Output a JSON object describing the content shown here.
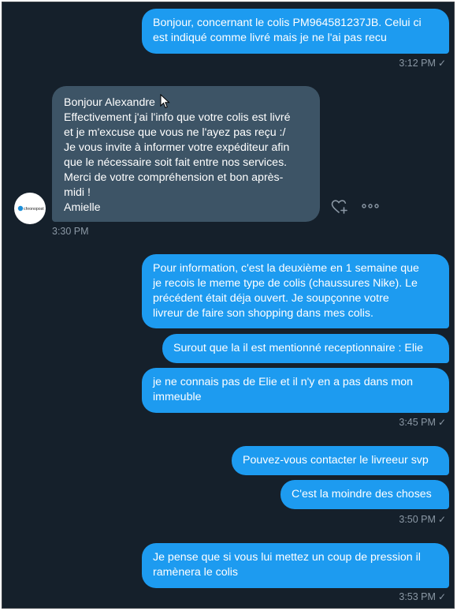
{
  "conversation": {
    "messages": [
      {
        "lines": [
          "Bonjour, concernant le colis PM964581237JB. Celui ci",
          "est indiqué comme livré mais je ne l'ai pas recu"
        ]
      },
      {
        "lines": [
          "Bonjour Alexandre",
          "Effectivement j'ai l'info que votre colis est livré",
          "et je m'excuse que vous ne l'ayez pas reçu :/",
          "Je vous invite à informer votre expéditeur afin",
          "que le nécessaire soit fait entre nos services.",
          "Merci de votre compréhension et bon après-",
          "midi !",
          "Amielle"
        ]
      },
      {
        "lines": [
          "Pour information, c'est la deuxième en 1 semaine que",
          "je recois le meme type de colis (chaussures Nike). Le",
          "précédent était déja ouvert. Je soupçonne votre",
          "livreur de faire son shopping dans mes colis."
        ]
      },
      {
        "lines": [
          "Surout que la il est mentionné receptionnaire : Elie"
        ]
      },
      {
        "lines": [
          "je ne connais pas de Elie et il n'y en a pas dans mon",
          "immeuble"
        ]
      },
      {
        "lines": [
          "Pouvez-vous contacter le livreeur svp"
        ]
      },
      {
        "lines": [
          "C'est la moindre des choses"
        ]
      },
      {
        "lines": [
          "Je pense que si vous lui mettez un coup de pression il",
          "ramènera le colis"
        ]
      }
    ],
    "timestamps": [
      "3:12 PM",
      "3:30 PM",
      "3:45 PM",
      "3:50 PM",
      "3:53 PM"
    ],
    "read_check": "✓",
    "avatar_label": "chronopost",
    "icons": {
      "like": "heart-plus-icon",
      "more": "more-horizontal-icon",
      "read": "checkmark-icon"
    },
    "colors": {
      "background": "#15202b",
      "sent_bubble": "#1d9bf0",
      "received_bubble": "#3d5466",
      "meta_text": "#8b98a5"
    }
  }
}
